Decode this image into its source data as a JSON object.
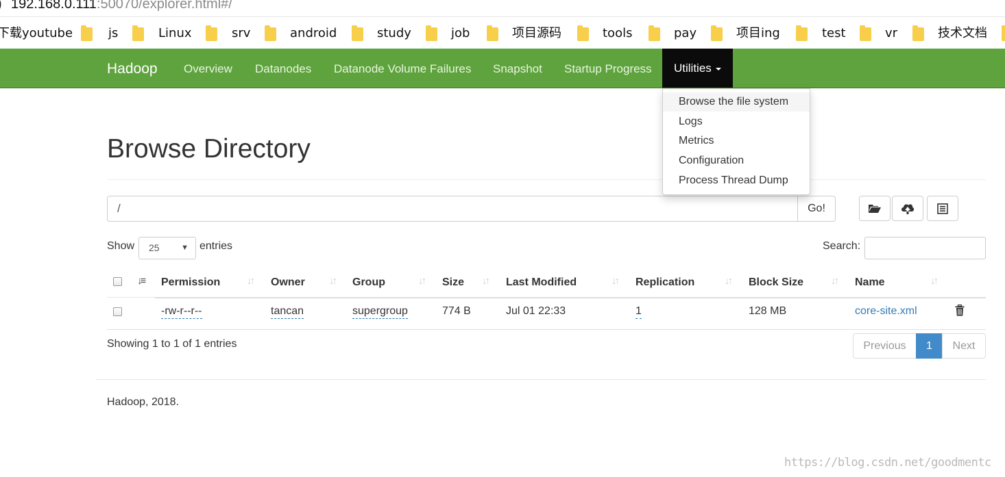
{
  "urlbar": {
    "prefix": ")",
    "host": "192.168.0.111",
    "path": ":50070/explorer.html#/"
  },
  "bookmarks": [
    {
      "label": "下载youtube",
      "folder": false
    },
    {
      "label": "js",
      "folder": true
    },
    {
      "label": "Linux",
      "folder": true
    },
    {
      "label": "srv",
      "folder": true
    },
    {
      "label": "android",
      "folder": true
    },
    {
      "label": "study",
      "folder": true
    },
    {
      "label": "job",
      "folder": true
    },
    {
      "label": "项目源码",
      "folder": true
    },
    {
      "label": "tools",
      "folder": true
    },
    {
      "label": "pay",
      "folder": true
    },
    {
      "label": "项目ing",
      "folder": true
    },
    {
      "label": "test",
      "folder": true
    },
    {
      "label": "vr",
      "folder": true
    },
    {
      "label": "技术文档",
      "folder": true
    }
  ],
  "navbar": {
    "brand": "Hadoop",
    "items": [
      "Overview",
      "Datanodes",
      "Datanode Volume Failures",
      "Snapshot",
      "Startup Progress"
    ],
    "active": "Utilities",
    "color": "#5fa33e"
  },
  "dropdown": {
    "items": [
      "Browse the file system",
      "Logs",
      "Metrics",
      "Configuration",
      "Process Thread Dump"
    ]
  },
  "page": {
    "title": "Browse Directory",
    "path_value": "/",
    "go_label": "Go!",
    "icons": [
      "folder-open-icon",
      "upload-cloud-icon",
      "list-icon"
    ]
  },
  "entries": {
    "show_label": "Show",
    "selected": "25",
    "suffix": "entries",
    "search_label": "Search:"
  },
  "table": {
    "columns": [
      "Permission",
      "Owner",
      "Group",
      "Size",
      "Last Modified",
      "Replication",
      "Block Size",
      "Name"
    ],
    "rows": [
      {
        "permission": "-rw-r--r--",
        "owner": "tancan",
        "group": "supergroup",
        "size": "774 B",
        "last_modified": "Jul 01 22:33",
        "replication": "1",
        "block_size": "128 MB",
        "name": "core-site.xml"
      }
    ]
  },
  "showing": "Showing 1 to 1 of 1 entries",
  "pagination": {
    "previous": "Previous",
    "current": "1",
    "next": "Next",
    "accent": "#428bca"
  },
  "footer": "Hadoop, 2018.",
  "watermark": "https://blog.csdn.net/goodmentc"
}
